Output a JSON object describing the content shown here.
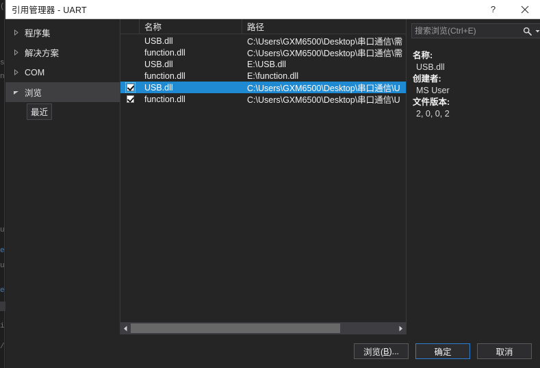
{
  "window": {
    "title": "引用管理器 - UART",
    "help_label": "?",
    "close_label": "✕",
    "help_icon": "question-mark-icon",
    "close_icon": "close-icon"
  },
  "sidebar": {
    "items": [
      {
        "label": "程序集",
        "expanded": false,
        "selected": false
      },
      {
        "label": "解决方案",
        "expanded": false,
        "selected": false
      },
      {
        "label": "COM",
        "expanded": false,
        "selected": false
      },
      {
        "label": "浏览",
        "expanded": true,
        "selected": true
      }
    ],
    "sub_items": [
      {
        "label": "最近"
      }
    ]
  },
  "list": {
    "columns": [
      "名称",
      "路径"
    ],
    "rows": [
      {
        "checked": false,
        "name": "USB.dll",
        "path": "C:\\Users\\GXM6500\\Desktop\\串口通信\\需",
        "selected": false
      },
      {
        "checked": false,
        "name": "function.dll",
        "path": "C:\\Users\\GXM6500\\Desktop\\串口通信\\需",
        "selected": false
      },
      {
        "checked": false,
        "name": "USB.dll",
        "path": "E:\\USB.dll",
        "selected": false
      },
      {
        "checked": false,
        "name": "function.dll",
        "path": "E:\\function.dll",
        "selected": false
      },
      {
        "checked": true,
        "name": "USB.dll",
        "path": "C:\\Users\\GXM6500\\Desktop\\串口通信\\U",
        "selected": true
      },
      {
        "checked": true,
        "name": "function.dll",
        "path": "C:\\Users\\GXM6500\\Desktop\\串口通信\\U",
        "selected": false
      }
    ],
    "scrollbar": {
      "left_arrow_icon": "chevron-left-icon",
      "right_arrow_icon": "chevron-right-icon",
      "thumb_percent": 79
    }
  },
  "search": {
    "placeholder": "搜索浏览(Ctrl+E)",
    "value": "",
    "icon": "search-icon",
    "dropdown_icon": "chevron-down-icon"
  },
  "properties": [
    {
      "label": "名称:",
      "value": "USB.dll"
    },
    {
      "label": "创建者:",
      "value": "MS User"
    },
    {
      "label": "文件版本:",
      "value": "2, 0, 0, 2"
    }
  ],
  "footer": {
    "browse_label_pre": "浏览(",
    "browse_accel": "B",
    "browse_label_post": ")...",
    "ok_label": "确定",
    "cancel_label": "取消"
  },
  "colors": {
    "dialog_bg": "#252526",
    "titlebar_bg": "#ffffff",
    "selection_blue": "#1f8ad2",
    "default_button_border": "#2f7fd0",
    "text": "#f0f0f0"
  }
}
